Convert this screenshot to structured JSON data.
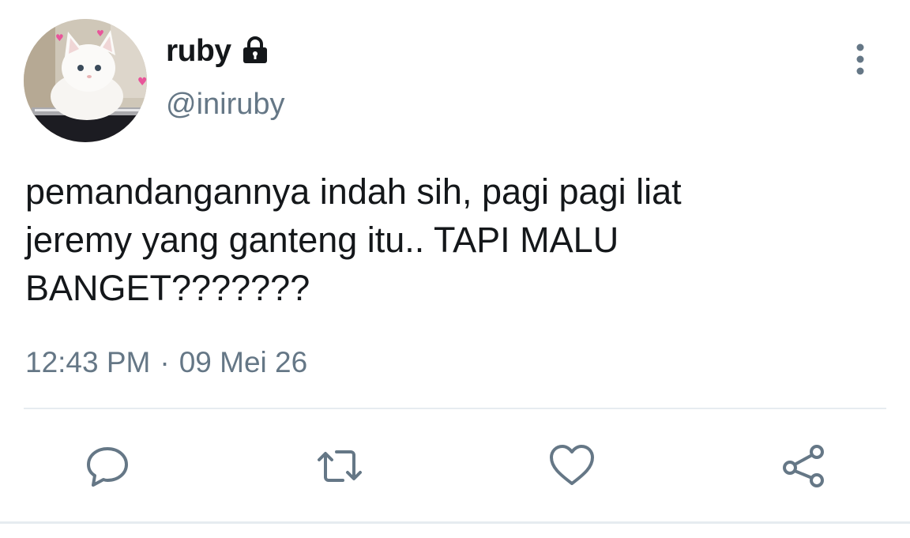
{
  "user": {
    "display_name": "ruby",
    "handle": "@iniruby",
    "protected": true,
    "avatar": "white-cat-avatar"
  },
  "tweet": {
    "text": "pemandangannya indah sih, pagi pagi liat\njeremy yang ganteng itu.. TAPI MALU\nBANGET???????",
    "time": "12:43 PM",
    "separator": "·",
    "date": "09 Mei 26"
  },
  "actions": {
    "reply_icon": "reply-icon",
    "retweet_icon": "retweet-icon",
    "like_icon": "like-icon",
    "share_icon": "share-icon",
    "more_icon": "more-vertical-icon"
  },
  "colors": {
    "text": "#14171a",
    "secondary": "#657786",
    "divider": "#e6ecf0",
    "icon": "#657786"
  }
}
